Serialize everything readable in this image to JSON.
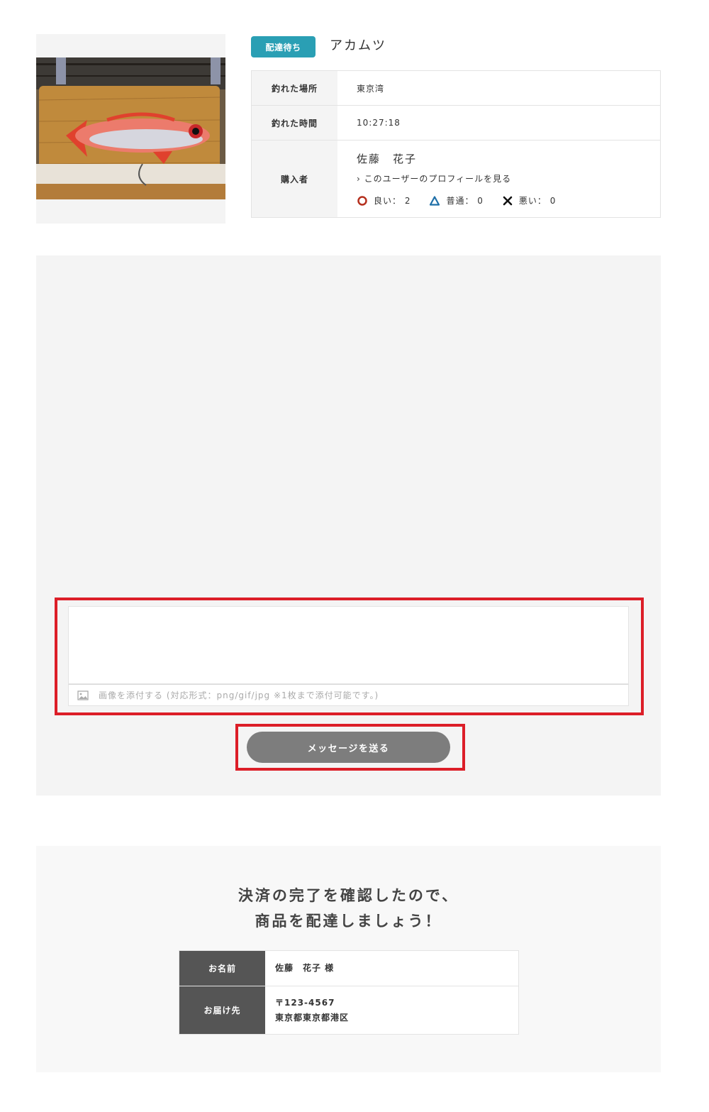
{
  "product": {
    "status_badge": "配達待ち",
    "title": "アカムツ",
    "image_alt": "fish-photo"
  },
  "info": {
    "location_label": "釣れた場所",
    "location_value": "東京湾",
    "time_label": "釣れた時間",
    "time_value": "10:27:18",
    "buyer_label": "購入者",
    "buyer_name": "佐藤　花子",
    "profile_link": "› このユーザーのプロフィールを見る",
    "ratings": [
      {
        "icon": "circle-icon",
        "color": "#b5301e",
        "text": "良い： 2"
      },
      {
        "icon": "triangle-icon",
        "color": "#1f6fa8",
        "text": "普通： 0"
      },
      {
        "icon": "cross-icon",
        "color": "#111111",
        "text": "悪い： 0"
      }
    ]
  },
  "message": {
    "textarea_value": "",
    "attach_label": "画像を添付する (対応形式：png/gif/jpg ※1枚まで添付可能です。)",
    "send_label": "メッセージを送る"
  },
  "delivery": {
    "heading_line1": "決済の完了を確認したので、",
    "heading_line2": "商品を配達しましょう！",
    "name_label": "お名前",
    "name_value": "佐藤　花子 様",
    "address_label": "お届け先",
    "postal_code": "〒123-4567",
    "address_value": "東京都東京都港区"
  },
  "colors": {
    "badge": "#2a9fb4",
    "highlight": "#dc1e28",
    "send_button": "#7d7d7d",
    "table_header_dark": "#555555"
  }
}
